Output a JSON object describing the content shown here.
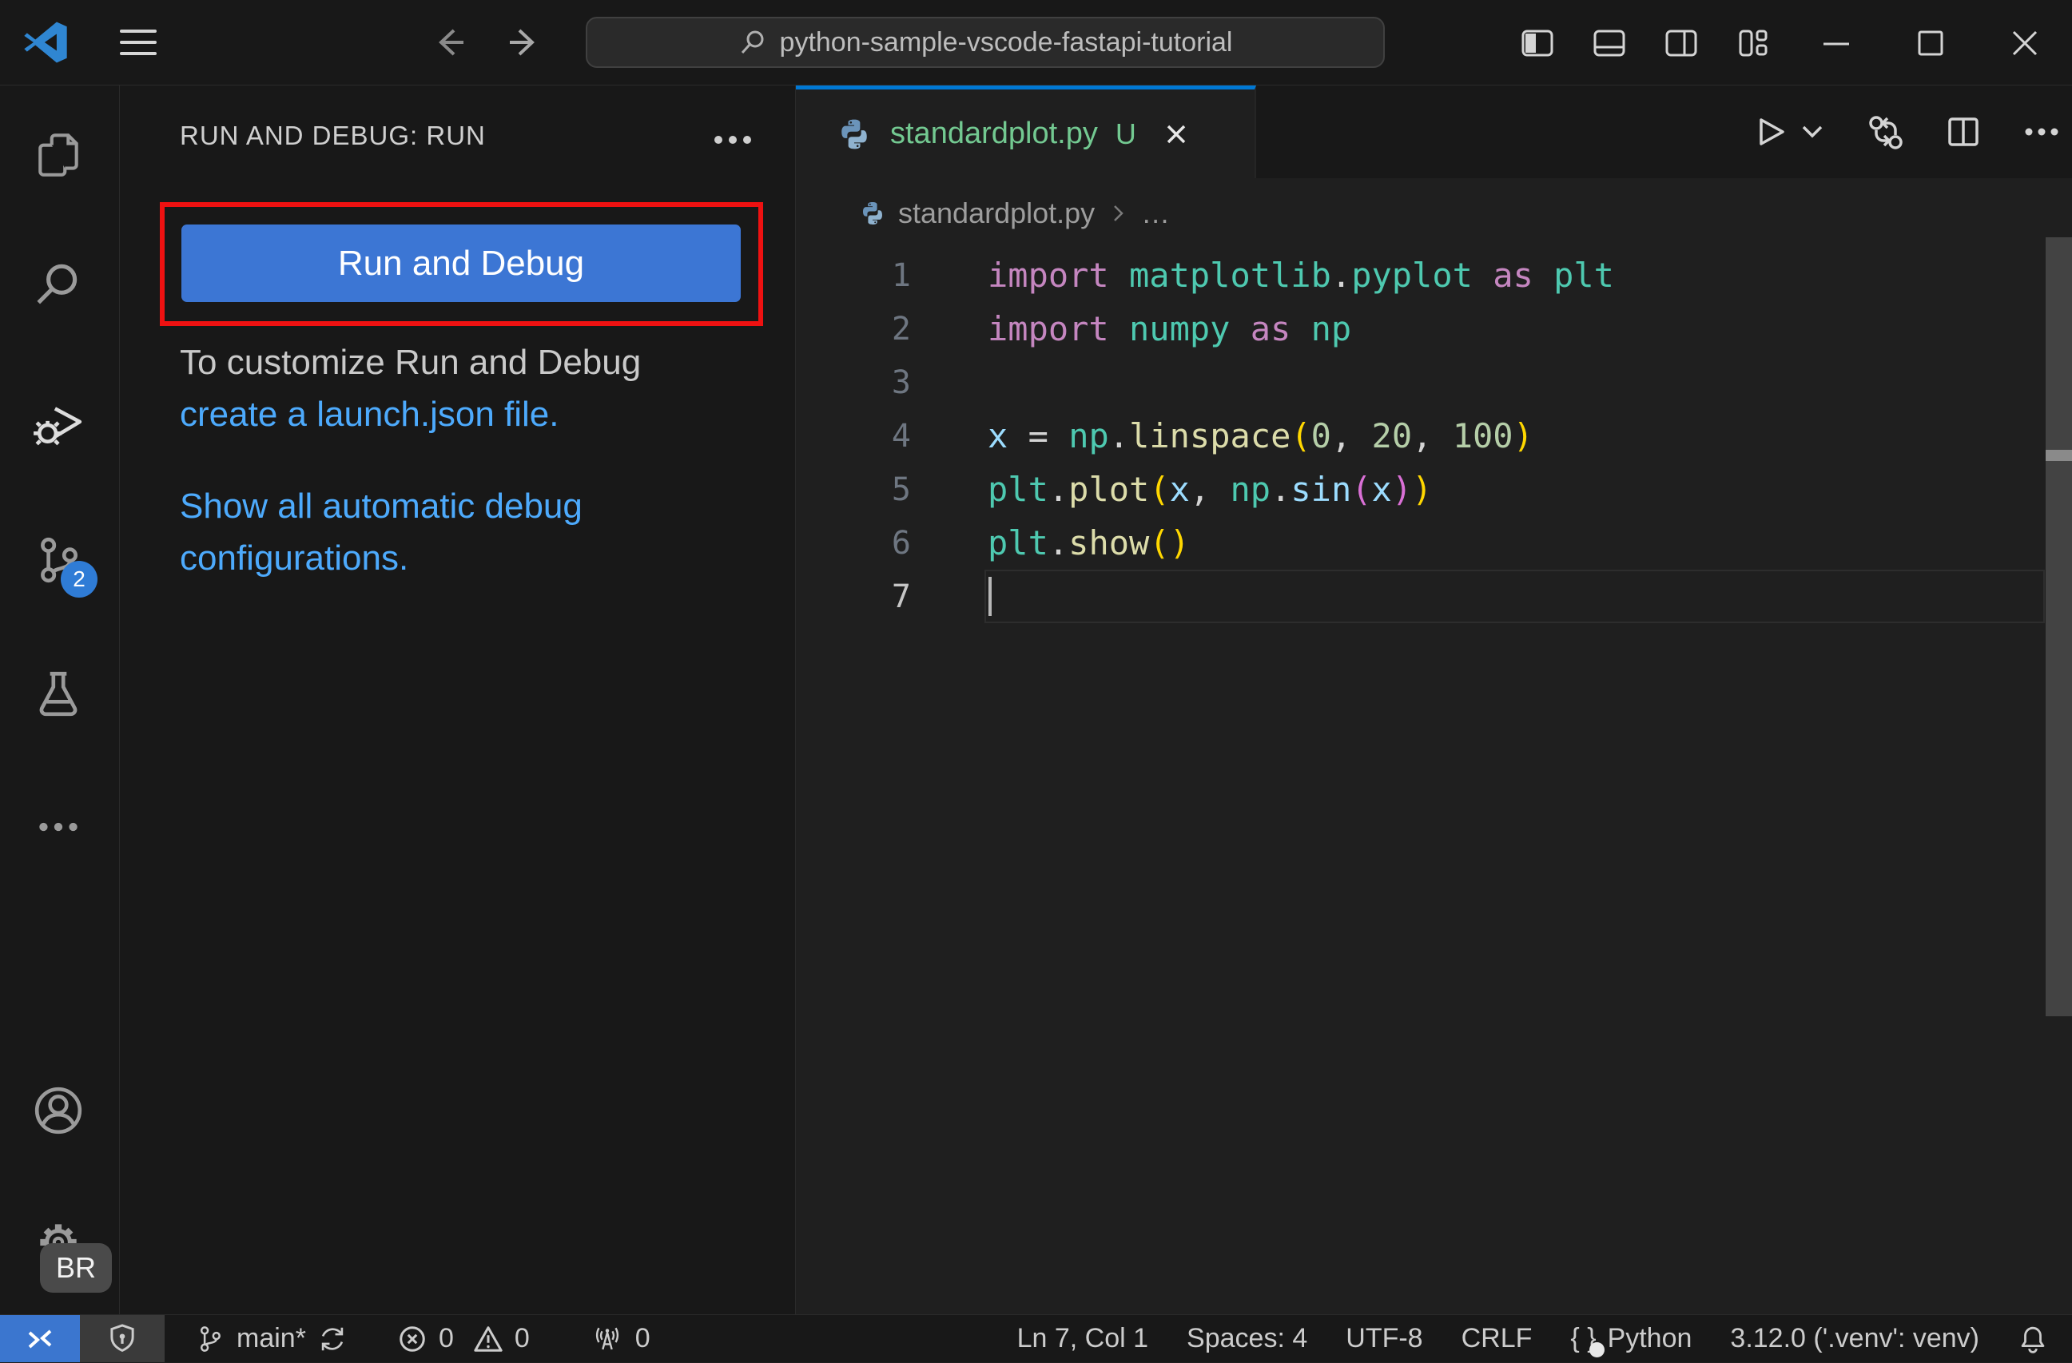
{
  "colors": {
    "accent_blue": "#0078d4",
    "button_blue": "#3c76d4",
    "link_blue": "#4daafc",
    "annotation_red": "#ee1111",
    "untracked_green": "#73c991",
    "badge_blue": "#2f7cd6",
    "remote_blue": "#3b76cf",
    "token_keyword": "#C586C0",
    "token_module": "#4EC9B0",
    "token_function": "#DCDCAA",
    "token_variable": "#9CDCFE",
    "token_number": "#B5CEA8",
    "token_bracket1": "#FFD700",
    "token_bracket2": "#DA70D6"
  },
  "title_bar": {
    "search_value": "python-sample-vscode-fastapi-tutorial"
  },
  "activity_bar": {
    "source_control_badge": "2",
    "profile_badge": "BR"
  },
  "sidebar": {
    "header": "RUN AND DEBUG: RUN",
    "run_button_label": "Run and Debug",
    "customize_text": "To customize Run and Debug ",
    "customize_link": "create a launch.json file.",
    "auto_configs_link": "Show all automatic debug configurations."
  },
  "tab": {
    "filename": "standardplot.py",
    "modified_indicator": "U"
  },
  "breadcrumb": {
    "file": "standardplot.py",
    "ellipsis": "…"
  },
  "editor": {
    "lines": [
      {
        "num": "1",
        "tokens": [
          [
            "import",
            "kw"
          ],
          [
            " ",
            "pln"
          ],
          [
            "matplotlib",
            "mod"
          ],
          [
            ".",
            "pln"
          ],
          [
            "pyplot",
            "mod"
          ],
          [
            " ",
            "pln"
          ],
          [
            "as",
            "kw"
          ],
          [
            " ",
            "pln"
          ],
          [
            "plt",
            "mod"
          ]
        ]
      },
      {
        "num": "2",
        "tokens": [
          [
            "import",
            "kw"
          ],
          [
            " ",
            "pln"
          ],
          [
            "numpy",
            "mod"
          ],
          [
            " ",
            "pln"
          ],
          [
            "as",
            "kw"
          ],
          [
            " ",
            "pln"
          ],
          [
            "np",
            "mod"
          ]
        ]
      },
      {
        "num": "3",
        "tokens": []
      },
      {
        "num": "4",
        "tokens": [
          [
            "x",
            "var"
          ],
          [
            " ",
            "pln"
          ],
          [
            "=",
            "pln"
          ],
          [
            " ",
            "pln"
          ],
          [
            "np",
            "mod"
          ],
          [
            ".",
            "pln"
          ],
          [
            "linspace",
            "fn"
          ],
          [
            "(",
            "b1"
          ],
          [
            "0",
            "num"
          ],
          [
            ",",
            "pln"
          ],
          [
            " ",
            "pln"
          ],
          [
            "20",
            "num"
          ],
          [
            ",",
            "pln"
          ],
          [
            " ",
            "pln"
          ],
          [
            "100",
            "num"
          ],
          [
            ")",
            "b1"
          ]
        ]
      },
      {
        "num": "5",
        "tokens": [
          [
            "plt",
            "mod"
          ],
          [
            ".",
            "pln"
          ],
          [
            "plot",
            "fn"
          ],
          [
            "(",
            "b1"
          ],
          [
            "x",
            "var"
          ],
          [
            ",",
            "pln"
          ],
          [
            " ",
            "pln"
          ],
          [
            "np",
            "mod"
          ],
          [
            ".",
            "pln"
          ],
          [
            "sin",
            "var"
          ],
          [
            "(",
            "b2"
          ],
          [
            "x",
            "var"
          ],
          [
            ")",
            "b2"
          ],
          [
            ")",
            "b1"
          ]
        ]
      },
      {
        "num": "6",
        "tokens": [
          [
            "plt",
            "mod"
          ],
          [
            ".",
            "pln"
          ],
          [
            "show",
            "fn"
          ],
          [
            "(",
            "b1"
          ],
          [
            ")",
            "b1"
          ]
        ]
      },
      {
        "num": "7",
        "tokens": [],
        "current": true
      }
    ]
  },
  "status_bar": {
    "branch": "main*",
    "errors": "0",
    "warnings": "0",
    "ports": "0",
    "cursor_position": "Ln 7, Col 1",
    "indentation": "Spaces: 4",
    "encoding": "UTF-8",
    "eol": "CRLF",
    "braces": "{ }",
    "language": "Python",
    "interpreter": "3.12.0 ('.venv': venv)"
  }
}
